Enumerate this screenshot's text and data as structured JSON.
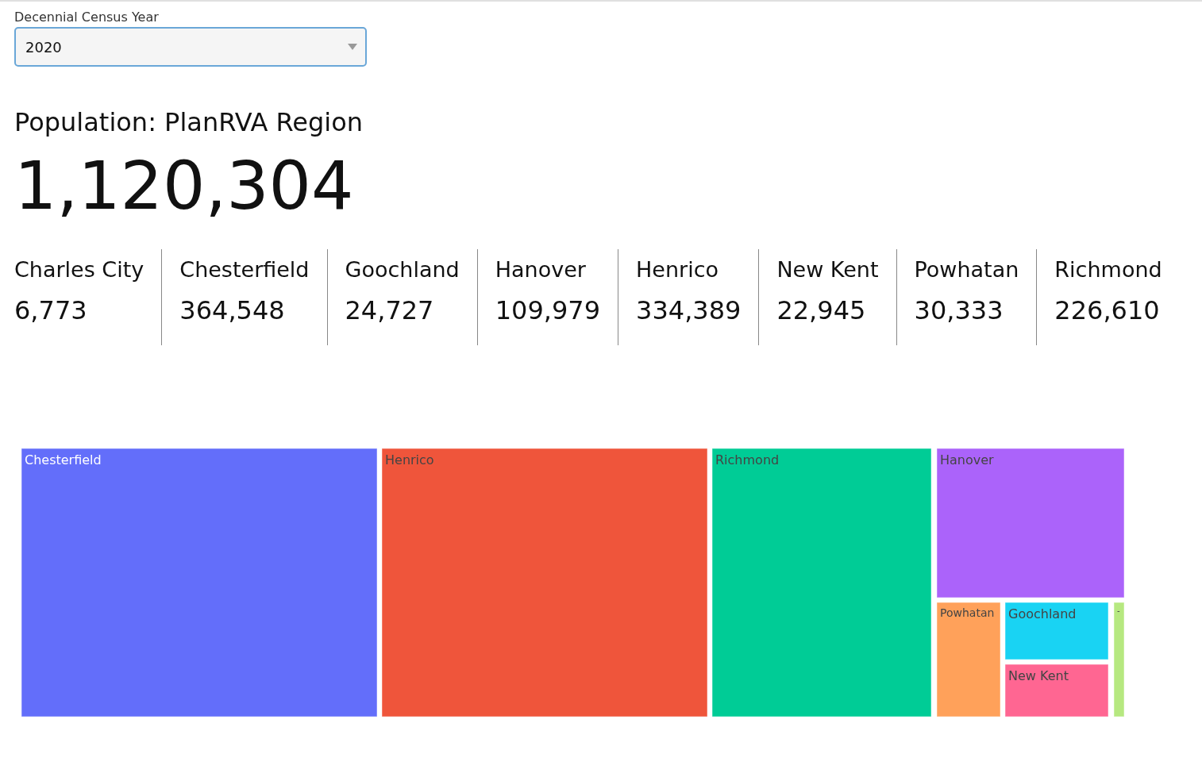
{
  "filter": {
    "label": "Decennial Census Year",
    "value": "2020"
  },
  "title": "Population: PlanRVA Region",
  "total": "1,120,304",
  "localities": [
    {
      "name": "Charles City",
      "population": "6,773"
    },
    {
      "name": "Chesterfield",
      "population": "364,548"
    },
    {
      "name": "Goochland",
      "population": "24,727"
    },
    {
      "name": "Hanover",
      "population": "109,979"
    },
    {
      "name": "Henrico",
      "population": "334,389"
    },
    {
      "name": "New Kent",
      "population": "22,945"
    },
    {
      "name": "Powhatan",
      "population": "30,333"
    },
    {
      "name": "Richmond",
      "population": "226,610"
    }
  ],
  "treemap": {
    "tiles": [
      {
        "label": "Chesterfield",
        "color": "#636efa"
      },
      {
        "label": "Henrico",
        "color": "#ef553b"
      },
      {
        "label": "Richmond",
        "color": "#00cc96"
      },
      {
        "label": "Hanover",
        "color": "#ab63fa"
      },
      {
        "label": "Powhatan",
        "color": "#ffa15a"
      },
      {
        "label": "Goochland",
        "color": "#19d3f3"
      },
      {
        "label": "New Kent",
        "color": "#ff6692"
      },
      {
        "label": "-",
        "color": "#b6e880"
      }
    ]
  }
}
